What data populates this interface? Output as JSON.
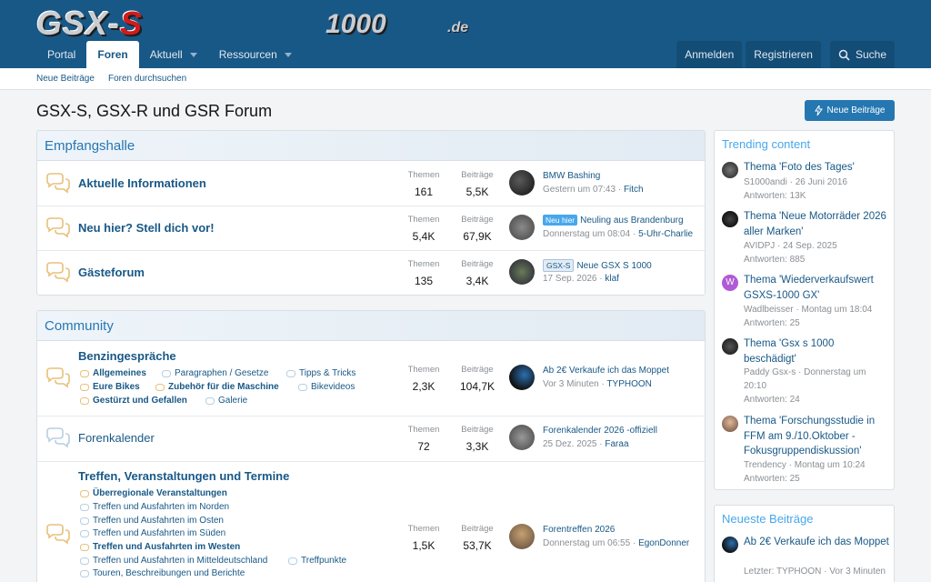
{
  "logo": {
    "text1": "GSX-",
    "text1b": "S",
    "text2": "1000",
    "text3": ".de"
  },
  "nav": {
    "tabs": [
      {
        "label": "Portal"
      },
      {
        "label": "Foren"
      },
      {
        "label": "Aktuell"
      },
      {
        "label": "Ressourcen"
      }
    ],
    "login": "Anmelden",
    "register": "Registrieren",
    "search": "Suche"
  },
  "subnav": {
    "new_posts": "Neue Beiträge",
    "search_forums": "Foren durchsuchen"
  },
  "page": {
    "title": "GSX-S, GSX-R und GSR Forum",
    "new_posts_button": "Neue Beiträge"
  },
  "labels": {
    "threads": "Themen",
    "posts": "Beiträge"
  },
  "categories": [
    {
      "title": "Empfangshalle",
      "nodes": [
        {
          "title": "Aktuelle Informationen",
          "threads": "161",
          "posts": "5,5K",
          "last_title": "BMW Bashing",
          "last_prefix": "",
          "last_date": "Gestern um 07:43",
          "last_user": "Fitch"
        },
        {
          "title": "Neu hier? Stell dich vor!",
          "threads": "5,4K",
          "posts": "67,9K",
          "last_title": "Neuling aus Brandenburg",
          "last_prefix": "Neu hier",
          "last_date": "Donnerstag um 08:04",
          "last_user": "5-Uhr-Charlie"
        },
        {
          "title": "Gästeforum",
          "threads": "135",
          "posts": "3,4K",
          "last_title": "Neue GSX S 1000",
          "last_prefix": "GSX-S",
          "last_date": "17 Sep. 2026",
          "last_user": "klaf"
        }
      ]
    },
    {
      "title": "Community",
      "nodes": [
        {
          "title": "Benzingespräche",
          "threads": "2,3K",
          "posts": "104,7K",
          "last_title": "Ab 2€ Verkaufe ich das Moppet",
          "last_date": "Vor 3 Minuten",
          "last_user": "TYPHOON",
          "subforums": [
            "Allgemeines",
            "Paragraphen / Gesetze",
            "Tipps & Tricks",
            "Eure Bikes",
            "Zubehör für die Maschine",
            "Bikevideos",
            "Gestürzt und Gefallen",
            "Galerie"
          ]
        },
        {
          "title": "Forenkalender",
          "threads": "72",
          "posts": "3,3K",
          "last_title": "Forenkalender 2026 -offiziell",
          "last_date": "25 Dez. 2025",
          "last_user": "Faraa"
        },
        {
          "title": "Treffen, Veranstaltungen und Termine",
          "threads": "1,5K",
          "posts": "53,7K",
          "last_title": "Forentreffen 2026",
          "last_date": "Donnerstag um 06:55",
          "last_user": "EgonDonner",
          "subforums": [
            "Überregionale Veranstaltungen",
            "Treffen und Ausfahrten im Norden",
            "Treffen und Ausfahrten im Osten",
            "Treffen und Ausfahrten im Süden",
            "Treffen und Ausfahrten im Westen",
            "Treffen und Ausfahrten in Mitteldeutschland",
            "Treffpunkte",
            "Touren, Beschreibungen und Berichte"
          ]
        }
      ]
    }
  ],
  "trending": {
    "title": "Trending content",
    "items": [
      {
        "title": "Thema 'Foto des Tages'",
        "meta": "S1000andi · 26 Juni 2016",
        "replies": "Antworten: 13K"
      },
      {
        "title": "Thema 'Neue Motorräder 2026 aller Marken'",
        "meta": "AVIDPJ · 24 Sep. 2025",
        "replies": "Antworten: 885"
      },
      {
        "title": "Thema 'Wiederverkaufswert GSXS-1000 GX'",
        "meta": "Wadlbeisser · Montag um 18:04",
        "replies": "Antworten: 25",
        "avatar_letter": "W"
      },
      {
        "title": "Thema 'Gsx s 1000 beschädigt'",
        "meta": "Paddy Gsx-s · Donnerstag um 20:10",
        "replies": "Antworten: 24"
      },
      {
        "title": "Thema 'Forschungsstudie in FFM am 9./10.Oktober - Fokusgruppendiskussion'",
        "meta": "Trendency · Montag um 10:24",
        "replies": "Antworten: 25"
      }
    ]
  },
  "latest": {
    "title": "Neueste Beiträge",
    "items": [
      {
        "title": "Ab 2€ Verkaufe ich das Moppet",
        "meta": "Letzter: TYPHOON · Vor 3 Minuten"
      }
    ]
  },
  "colors": {
    "header": "#185886",
    "accent": "#2577b1",
    "link": "#185886",
    "muted": "#8a8f94"
  }
}
